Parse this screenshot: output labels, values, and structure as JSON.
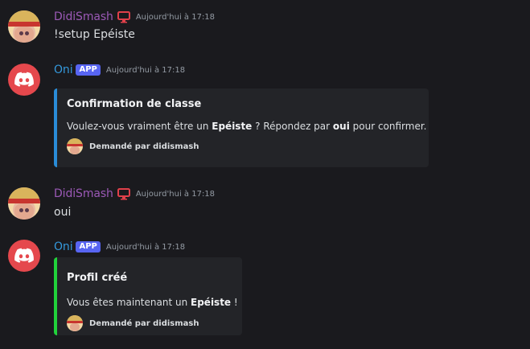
{
  "colors": {
    "background": "#1a1a1e",
    "user_name": "#9b59b6",
    "bot_name": "#3498db",
    "embed_confirm_bar": "#2a8cd8",
    "embed_created_bar": "#21d23b",
    "app_badge": "#5865f2",
    "desktop_icon": "#e0404a",
    "bot_avatar": "#e5484d"
  },
  "messages": [
    {
      "author": "DidiSmash",
      "timestamp": "Aujourd'hui à 17:18",
      "content": "!setup Epéiste",
      "icon": "desktop-icon"
    },
    {
      "author": "Oni",
      "badge": "APP",
      "timestamp": "Aujourd'hui à 17:18",
      "embed": {
        "title": "Confirmation de classe",
        "desc_before": "Voulez-vous vraiment être un ",
        "desc_bold1": "Epéiste",
        "desc_middle": " ? Répondez par ",
        "desc_bold2": "oui",
        "desc_after": " pour confirmer.",
        "footer": "Demandé par didismash"
      }
    },
    {
      "author": "DidiSmash",
      "timestamp": "Aujourd'hui à 17:18",
      "content": "oui",
      "icon": "desktop-icon"
    },
    {
      "author": "Oni",
      "badge": "APP",
      "timestamp": "Aujourd'hui à 17:18",
      "embed": {
        "title": "Profil créé",
        "desc_before": "Vous êtes maintenant un ",
        "desc_bold1": "Epéiste",
        "desc_after": " !",
        "footer": "Demandé par didismash"
      }
    }
  ]
}
